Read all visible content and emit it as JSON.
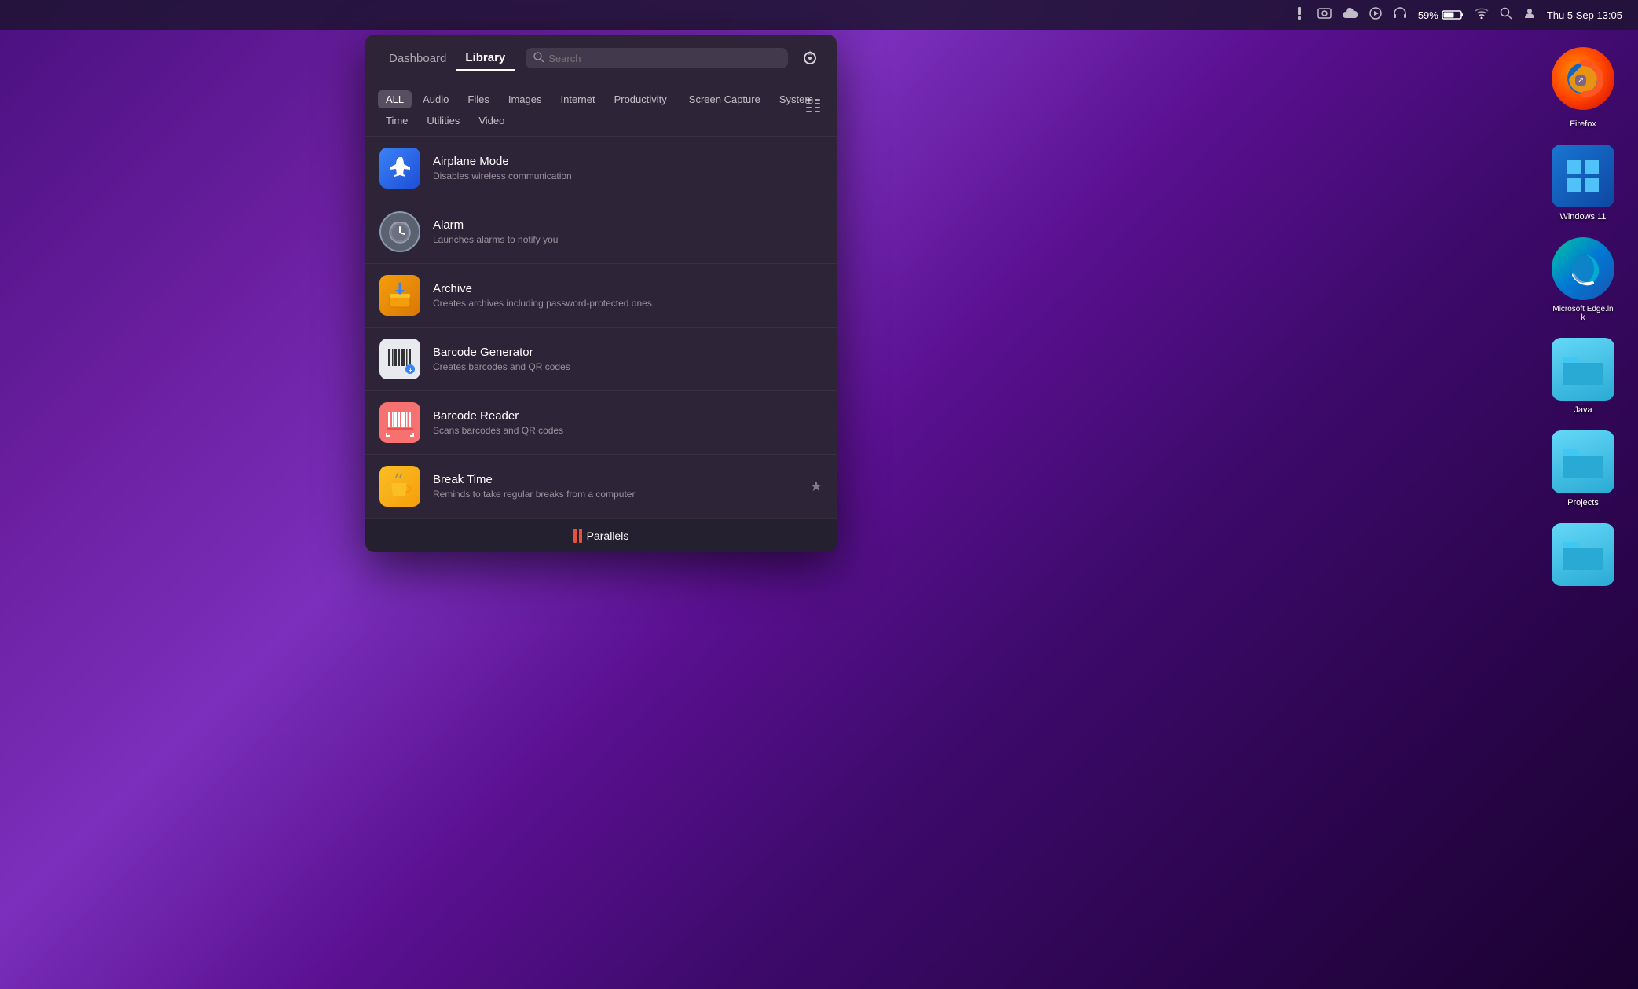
{
  "menubar": {
    "datetime": "Thu 5 Sep  13:05",
    "battery_percent": "59%",
    "icons": [
      "tools",
      "photo",
      "cloud",
      "play",
      "headphones",
      "wifi",
      "search",
      "person"
    ]
  },
  "tabs": {
    "dashboard": "Dashboard",
    "library": "Library"
  },
  "search": {
    "placeholder": "Search"
  },
  "categories": [
    {
      "id": "all",
      "label": "ALL",
      "active": true
    },
    {
      "id": "audio",
      "label": "Audio",
      "active": false
    },
    {
      "id": "files",
      "label": "Files",
      "active": false
    },
    {
      "id": "images",
      "label": "Images",
      "active": false
    },
    {
      "id": "internet",
      "label": "Internet",
      "active": false
    },
    {
      "id": "productivity",
      "label": "Productivity",
      "active": false
    },
    {
      "id": "screen-capture",
      "label": "Screen Capture",
      "active": false
    },
    {
      "id": "system",
      "label": "System",
      "active": false
    },
    {
      "id": "time",
      "label": "Time",
      "active": false
    },
    {
      "id": "utilities",
      "label": "Utilities",
      "active": false
    },
    {
      "id": "video",
      "label": "Video",
      "active": false
    }
  ],
  "library_items": [
    {
      "id": "airplane-mode",
      "name": "Airplane Mode",
      "description": "Disables wireless communication",
      "icon_type": "airplane",
      "starred": false
    },
    {
      "id": "alarm",
      "name": "Alarm",
      "description": "Launches alarms to notify you",
      "icon_type": "alarm",
      "starred": false
    },
    {
      "id": "archive",
      "name": "Archive",
      "description": "Creates archives including password-protected ones",
      "icon_type": "archive",
      "starred": false
    },
    {
      "id": "barcode-generator",
      "name": "Barcode Generator",
      "description": "Creates barcodes and QR codes",
      "icon_type": "barcode-gen",
      "starred": false
    },
    {
      "id": "barcode-reader",
      "name": "Barcode Reader",
      "description": "Scans barcodes and QR codes",
      "icon_type": "barcode-read",
      "starred": false
    },
    {
      "id": "break-time",
      "name": "Break Time",
      "description": "Reminds to take regular breaks from a computer",
      "icon_type": "break",
      "starred": true
    }
  ],
  "dock_items": [
    {
      "id": "firefox",
      "label": "Firefox",
      "icon": "🦊",
      "color": "#ff6600"
    },
    {
      "id": "windows11",
      "label": "Windows 11",
      "icon": "⬛",
      "color": "#0078d4"
    },
    {
      "id": "edge",
      "label": "Microsoft Edge.lnk",
      "icon": "🌐",
      "color": "#0078d4"
    },
    {
      "id": "java",
      "label": "Java",
      "icon": "📁",
      "color": "#40c8f4"
    },
    {
      "id": "projects",
      "label": "Projects",
      "icon": "📁",
      "color": "#40c8f4"
    },
    {
      "id": "folder5",
      "label": "",
      "icon": "📁",
      "color": "#40c8f4"
    }
  ],
  "footer": {
    "brand": "Parallels"
  }
}
